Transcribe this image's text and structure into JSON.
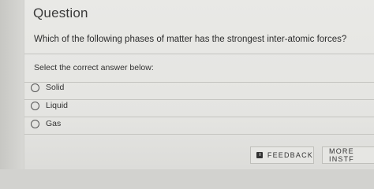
{
  "question": {
    "heading": "Question",
    "text": "Which of the following phases of matter has the strongest inter-atomic forces?",
    "instruction": "Select the correct answer below:",
    "options": [
      {
        "label": "Solid"
      },
      {
        "label": "Liquid"
      },
      {
        "label": "Gas"
      }
    ]
  },
  "footer": {
    "feedback_label": "FEEDBACK",
    "feedback_icon": "feedback-icon",
    "more_label": "MORE INSTF"
  }
}
